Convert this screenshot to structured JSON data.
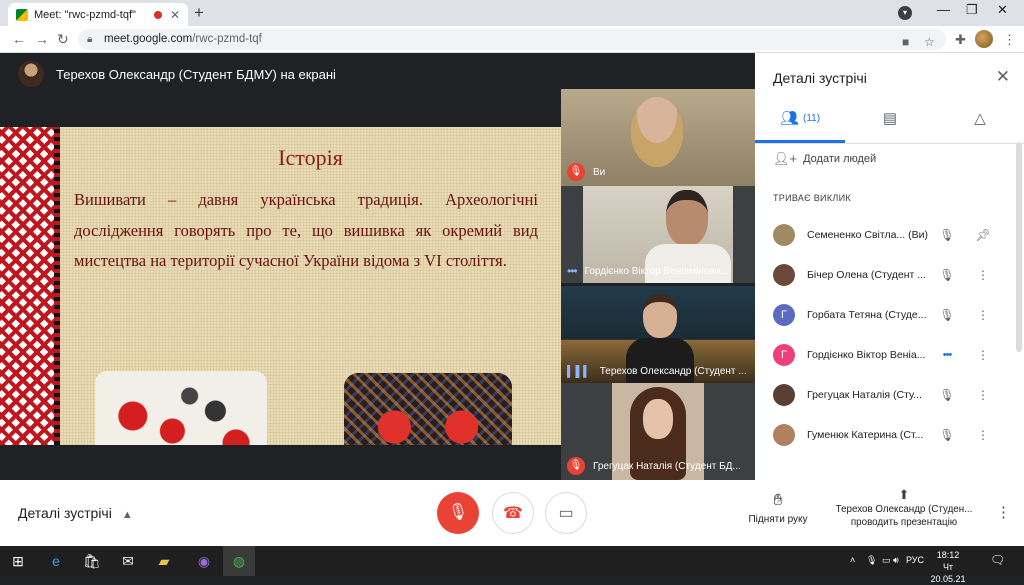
{
  "browser": {
    "tab_title": "Meet: \"rwc-pzmd-tqf\"",
    "tab_close": "✕",
    "new_tab": "+",
    "url_host": "meet.google.com",
    "url_path": "/rwc-pzmd-tqf"
  },
  "presenter": {
    "banner": "Терехов Олександр (Студент БДМУ) на екрані"
  },
  "slide": {
    "title": "Історія",
    "text": "Вишивати – давня українська традиція. Археологічні дослідження говорять про те, що вишивка як окремий вид мистецтва на території сучасної України відома з VI століття."
  },
  "tiles": [
    {
      "label": "Ви"
    },
    {
      "label": "Гордієнко Віктор Веніамінови..."
    },
    {
      "label": "Терехов Олександр (Студент ..."
    },
    {
      "label": "Грегуцак Наталія (Студент БД..."
    }
  ],
  "panel": {
    "title": "Деталі зустрічі",
    "people_count": "(11)",
    "add_people": "Додати людей",
    "section_label": "ТРИВАЄ ВИКЛИК",
    "participants": [
      {
        "name": "Семененко Світла...",
        "suffix": "(Ви)",
        "avatar_letter": "",
        "avatar_color": "#a08a63"
      },
      {
        "name": "Бічер Олена (Студент ...",
        "suffix": "",
        "avatar_letter": "",
        "avatar_color": "#6b4a3a"
      },
      {
        "name": "Горбата Тетяна (Студе...",
        "suffix": "",
        "avatar_letter": "Г",
        "avatar_color": "#5c6bc0"
      },
      {
        "name": "Гордієнко Віктор Веніа...",
        "suffix": "",
        "avatar_letter": "Г",
        "avatar_color": "#ec407a"
      },
      {
        "name": "Грегуцак Наталія (Сту...",
        "suffix": "",
        "avatar_letter": "",
        "avatar_color": "#5a4032"
      },
      {
        "name": "Гуменюк Катерина (Ст...",
        "suffix": "",
        "avatar_letter": "",
        "avatar_color": "#b08060"
      }
    ]
  },
  "bottom": {
    "meeting_details": "Деталі зустрічі",
    "raise_hand": "Підняти руку",
    "presenting_line1": "Терехов Олександр (Студен...",
    "presenting_line2": "проводить презентацію"
  },
  "taskbar": {
    "lang": "РУС",
    "time": "18:12",
    "date": "Чт 20.05.21"
  },
  "colors": {
    "accent": "#1a73e8",
    "danger": "#ea4335"
  }
}
